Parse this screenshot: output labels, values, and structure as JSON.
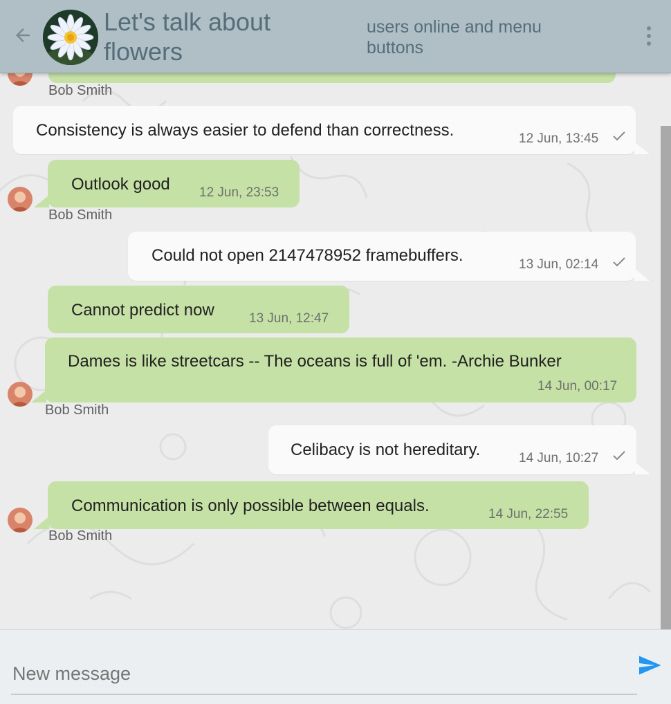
{
  "header": {
    "back_icon": "arrow-left-icon",
    "title": "Let's talk about flowers",
    "status": "users online and menu buttons",
    "menu_icon": "more-vertical-icon",
    "accent": "#b0bec5"
  },
  "messages": [
    {
      "sender": "Bob Smith"
    },
    {
      "text": "Consistency is always easier to defend than correctness.",
      "time": "12 Jun, 13:45"
    },
    {
      "text": "Outlook good",
      "time": "12 Jun, 23:53",
      "sender": "Bob Smith"
    },
    {
      "text": "Could not open 2147478952 framebuffers.",
      "time": "13 Jun, 02:14"
    },
    {
      "text": "Cannot predict now",
      "time": "13 Jun, 12:47"
    },
    {
      "text": "Dames is like streetcars -- The oceans is full of 'em. -Archie Bunker",
      "time": "14 Jun, 00:17",
      "sender": "Bob Smith"
    },
    {
      "text": "Celibacy is not hereditary.",
      "time": "14 Jun, 10:27"
    },
    {
      "text": "Communication is only possible between equals.",
      "time": "14 Jun, 22:55",
      "sender": "Bob Smith"
    }
  ],
  "colors": {
    "incoming_bubble": "#c5e1a5",
    "outgoing_bubble": "#fafafa",
    "send_button": "#2196f3"
  },
  "composer": {
    "placeholder": "New message",
    "send_icon": "send-icon"
  }
}
